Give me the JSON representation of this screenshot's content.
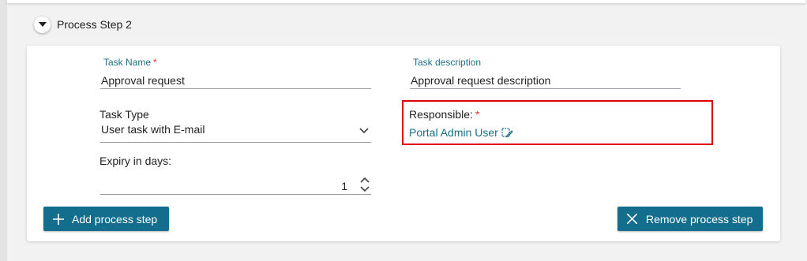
{
  "step": {
    "title": "Process Step 2"
  },
  "task_name": {
    "label": "Task Name",
    "required_mark": "*",
    "value": "Approval request"
  },
  "task_description": {
    "label": "Task description",
    "value": "Approval request description"
  },
  "task_type": {
    "label": "Task Type",
    "value": "User task with E-mail"
  },
  "responsible": {
    "label": "Responsible:",
    "required_mark": "*",
    "value": "Portal Admin User"
  },
  "expiry": {
    "label": "Expiry in days:",
    "value": "1"
  },
  "buttons": {
    "add": "Add process step",
    "remove": "Remove process step"
  },
  "icons": {
    "toggle": "caret-down-icon",
    "edit": "edit-user-icon",
    "stepper": "stepper-icon",
    "select": "chevron-down-icon",
    "add": "plus-icon",
    "remove": "close-icon"
  },
  "colors": {
    "accent": "#136e8d",
    "label": "#1e6e86",
    "required": "#dd3333",
    "highlight": "#e0000b"
  }
}
